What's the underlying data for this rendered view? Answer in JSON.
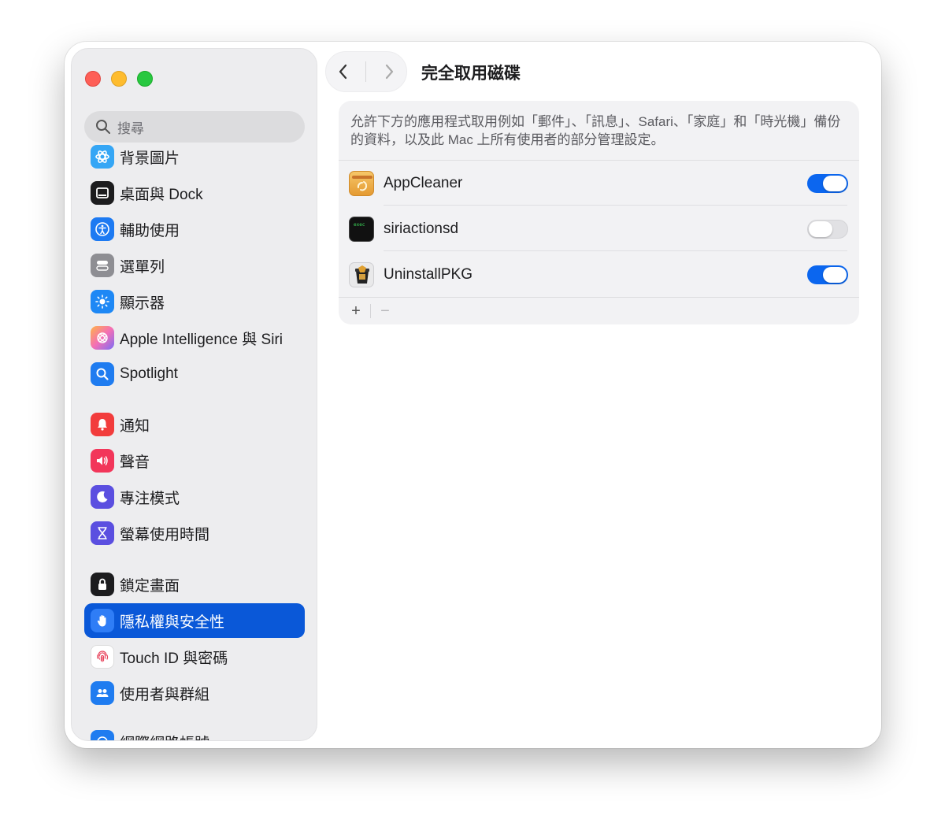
{
  "window": {
    "title": "完全取用磁碟"
  },
  "sidebar": {
    "search_placeholder": "搜尋",
    "items": [
      {
        "label": "背景圖片",
        "icon": "wallpaper-icon",
        "color": "#35a6f5"
      },
      {
        "label": "桌面與 Dock",
        "icon": "dock-icon",
        "color": "#1c1c1e"
      },
      {
        "label": "輔助使用",
        "icon": "accessibility-icon",
        "color": "#1d7af2"
      },
      {
        "label": "選單列",
        "icon": "menubar-icon",
        "color": "#8e8e93"
      },
      {
        "label": "顯示器",
        "icon": "display-icon",
        "color": "#1e88f5"
      },
      {
        "label": "Apple Intelligence 與 Siri",
        "icon": "siri-icon",
        "color": "#f7a0c0"
      },
      {
        "label": "Spotlight",
        "icon": "spotlight-icon",
        "color": "#1f7cf0"
      },
      {
        "label": "通知",
        "icon": "notification-icon",
        "color": "#f23c3c"
      },
      {
        "label": "聲音",
        "icon": "sound-icon",
        "color": "#f2365a"
      },
      {
        "label": "專注模式",
        "icon": "focus-moon-icon",
        "color": "#5b4fe0"
      },
      {
        "label": "螢幕使用時間",
        "icon": "hourglass-icon",
        "color": "#5b4fe0"
      },
      {
        "label": "鎖定畫面",
        "icon": "lock-icon",
        "color": "#1c1c1e"
      },
      {
        "label": "隱私權與安全性",
        "icon": "hand-icon",
        "color": "#2f7df6",
        "selected": true
      },
      {
        "label": "Touch ID 與密碼",
        "icon": "fingerprint-icon",
        "color": "#ffffff"
      },
      {
        "label": "使用者與群組",
        "icon": "users-icon",
        "color": "#1f7cf0"
      },
      {
        "label": "網際網路帳號",
        "icon": "internet-accounts-icon",
        "color": "#1f7cf0"
      }
    ]
  },
  "main": {
    "description": "允許下方的應用程式取用例如「郵件」、「訊息」、Safari、「家庭」和「時光機」備份的資料，以及此 Mac 上所有使用者的部分管理設定。",
    "apps": [
      {
        "name": "AppCleaner",
        "enabled": true,
        "icon": "appcleaner-icon"
      },
      {
        "name": "siriactionsd",
        "enabled": false,
        "icon": "exec-terminal-icon"
      },
      {
        "name": "UninstallPKG",
        "enabled": true,
        "icon": "uninstallpkg-icon"
      }
    ],
    "add_label": "+",
    "remove_label": "−"
  },
  "colors": {
    "accent": "#0a58d8",
    "toggle_on": "#0b66ef"
  }
}
